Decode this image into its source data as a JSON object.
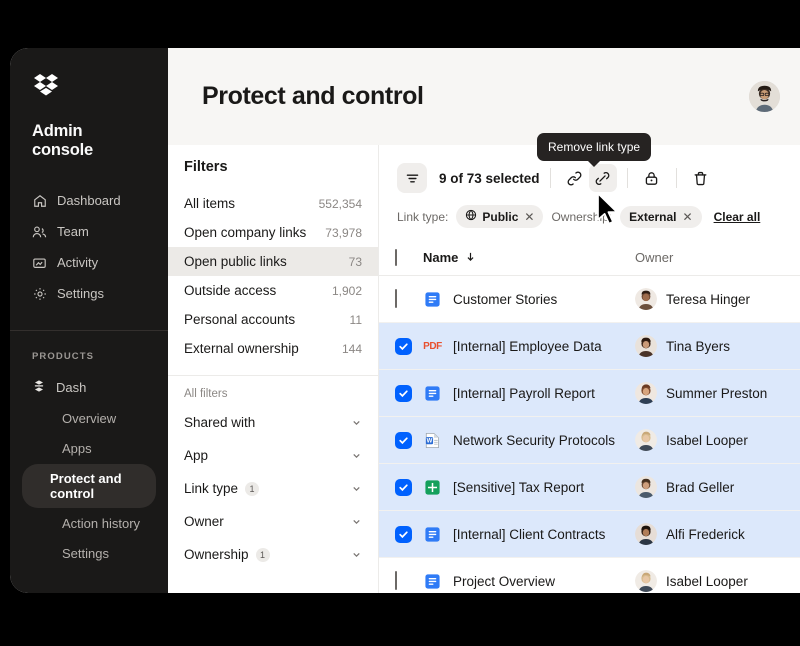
{
  "sidebar": {
    "logo_icon": "dropbox-logo-icon",
    "console_title": "Admin console",
    "nav": [
      {
        "label": "Dashboard",
        "icon": "home-icon"
      },
      {
        "label": "Team",
        "icon": "people-icon"
      },
      {
        "label": "Activity",
        "icon": "activity-icon"
      },
      {
        "label": "Settings",
        "icon": "gear-icon"
      }
    ],
    "section_label": "PRODUCTS",
    "product": {
      "label": "Dash",
      "icon": "dash-icon"
    },
    "product_items": [
      {
        "label": "Overview",
        "active": false
      },
      {
        "label": "Apps",
        "active": false
      },
      {
        "label": "Protect and control",
        "active": true
      },
      {
        "label": "Action history",
        "active": false
      },
      {
        "label": "Settings",
        "active": false
      }
    ]
  },
  "header": {
    "title": "Protect and control",
    "avatar_name": "user-avatar"
  },
  "filters": {
    "heading": "Filters",
    "items": [
      {
        "label": "All items",
        "count": "552,354",
        "selected": false
      },
      {
        "label": "Open company links",
        "count": "73,978",
        "selected": false
      },
      {
        "label": "Open public links",
        "count": "73",
        "selected": true
      },
      {
        "label": "Outside access",
        "count": "1,902",
        "selected": false
      },
      {
        "label": "Personal accounts",
        "count": "11",
        "selected": false
      },
      {
        "label": "External ownership",
        "count": "144",
        "selected": false
      }
    ],
    "all_filters_label": "All filters",
    "accordions": [
      {
        "label": "Shared with",
        "badge": ""
      },
      {
        "label": "App",
        "badge": ""
      },
      {
        "label": "Link type",
        "badge": "1"
      },
      {
        "label": "Owner",
        "badge": ""
      },
      {
        "label": "Ownership",
        "badge": "1"
      }
    ]
  },
  "toolbar": {
    "funnel_icon": "filter-funnel-icon",
    "selection_text": "9 of 73 selected",
    "actions": [
      {
        "icon": "link-icon",
        "name": "copy-link-button",
        "hover": false
      },
      {
        "icon": "broken-link-icon",
        "name": "remove-link-type-button",
        "hover": true
      },
      {
        "icon": "lock-icon",
        "name": "lock-button",
        "hover": false
      },
      {
        "icon": "trash-icon",
        "name": "delete-button",
        "hover": false
      }
    ],
    "tooltip": "Remove link type",
    "chips": [
      {
        "label": "Link type:",
        "value": "Public",
        "icon": "globe-icon"
      },
      {
        "label": "Ownership:",
        "value": "External",
        "icon": ""
      }
    ],
    "clear_all": "Clear all"
  },
  "table": {
    "columns": {
      "name": "Name",
      "owner": "Owner",
      "sort_icon": "sort-desc-arrow-icon"
    },
    "rows": [
      {
        "name": "Customer Stories",
        "owner": "Teresa Hinger",
        "type": "doc",
        "checked": false,
        "avatar": "#8a5a42"
      },
      {
        "name": "[Internal] Employee Data",
        "owner": "Tina Byers",
        "type": "pdf",
        "checked": true,
        "avatar": "#6b4a3a"
      },
      {
        "name": "[Internal] Payroll Report",
        "owner": "Summer Preston",
        "type": "doc",
        "checked": true,
        "avatar": "#9b6b52"
      },
      {
        "name": "Network Security Protocols",
        "owner": "Isabel Looper",
        "type": "word",
        "checked": true,
        "avatar": "#c7a98c"
      },
      {
        "name": "[Sensitive] Tax Report",
        "owner": "Brad Geller",
        "type": "sheet",
        "checked": true,
        "avatar": "#8d6b55"
      },
      {
        "name": "[Internal] Client Contracts",
        "owner": "Alfi Frederick",
        "type": "doc",
        "checked": true,
        "avatar": "#5e4335"
      },
      {
        "name": "Project Overview",
        "owner": "Isabel Looper",
        "type": "doc",
        "checked": false,
        "avatar": "#c7a98c"
      }
    ]
  },
  "colors": {
    "accent_blue": "#0061fe",
    "selected_row": "#dce8fb",
    "sidebar_bg": "#1a1918",
    "pdf_red": "#e8512f",
    "sheet_green": "#14a05c"
  }
}
